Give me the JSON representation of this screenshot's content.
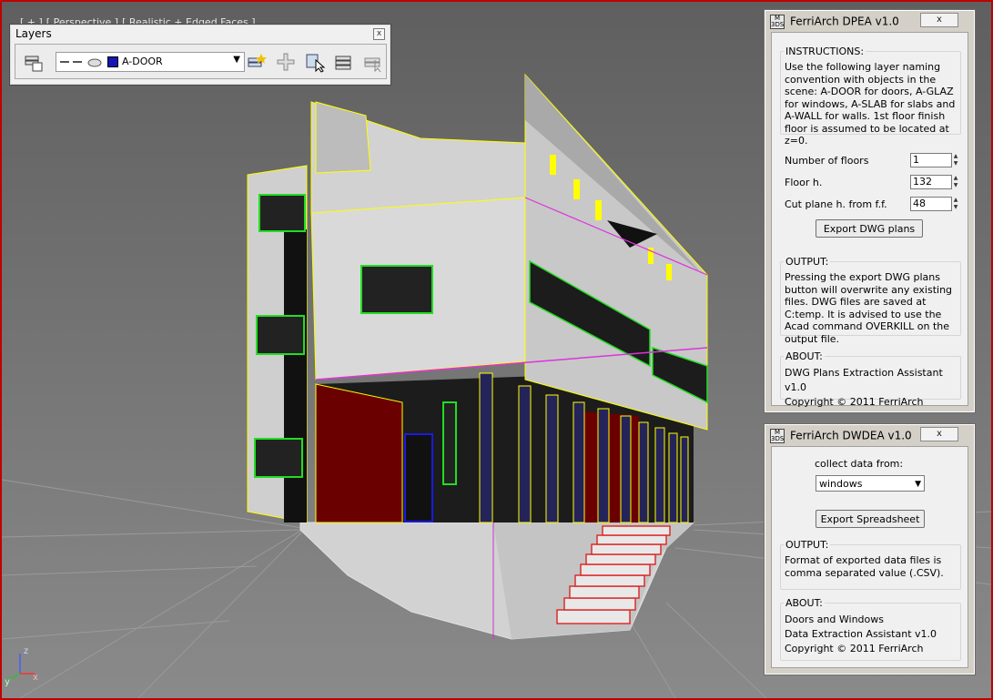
{
  "viewport": {
    "label_parts": [
      "[ + ]",
      "[ Perspective ]",
      "[ Realistic + Edged Faces ]"
    ],
    "axis_labels": {
      "z": "z",
      "x": "x",
      "y": "y"
    },
    "colors": {
      "background": "#6e6e6e",
      "border": "#c00000",
      "selection": "#ffff00"
    }
  },
  "layers_toolbar": {
    "title": "Layers",
    "close_glyph": "x",
    "current_layer": {
      "name": "A-DOOR",
      "color": "#1616b4"
    },
    "icons": [
      "layer-manager-icon",
      "visibility-toggles-icon",
      "create-layer-icon",
      "add-selection-icon",
      "select-objects-icon",
      "set-current-icon",
      "isolate-icon"
    ]
  },
  "dpea_panel": {
    "title": "FerriArch DPEA v1.0",
    "logo_text": "M 3DS",
    "close_glyph": "x",
    "instructions": {
      "label": "INSTRUCTIONS:",
      "text": "Use the following layer naming convention with objects in the scene: A-DOOR for doors, A-GLAZ for windows, A-SLAB for slabs and A-WALL for walls. 1st floor finish floor is assumed to be located at z=0."
    },
    "fields": {
      "floors_label": "Number of floors",
      "floors_value": "1",
      "floor_h_label": "Floor h.",
      "floor_h_value": "132",
      "cut_label": "Cut plane h. from f.f.",
      "cut_value": "48"
    },
    "export_button": "Export DWG plans",
    "output": {
      "label": "OUTPUT:",
      "text": "Pressing the export DWG plans button will overwrite any existing files. DWG files are saved at C:temp. It is advised to use the Acad command OVERKILL on the output file."
    },
    "about": {
      "label": "ABOUT:",
      "line1": "DWG Plans Extraction Assistant v1.0",
      "line2": "Copyright © 2011 FerriArch"
    }
  },
  "dwdea_panel": {
    "title": "FerriArch DWDEA v1.0",
    "logo_text": "M 3DS",
    "close_glyph": "x",
    "collect_label": "collect data from:",
    "collect_value": "windows",
    "export_button": "Export Spreadsheet",
    "output": {
      "label": "OUTPUT:",
      "text": "Format of exported data files is comma separated value (.CSV)."
    },
    "about": {
      "label": "ABOUT:",
      "line1": "Doors and Windows",
      "line2": "Data Extraction Assistant v1.0",
      "line3": "Copyright © 2011 FerriArch"
    }
  }
}
